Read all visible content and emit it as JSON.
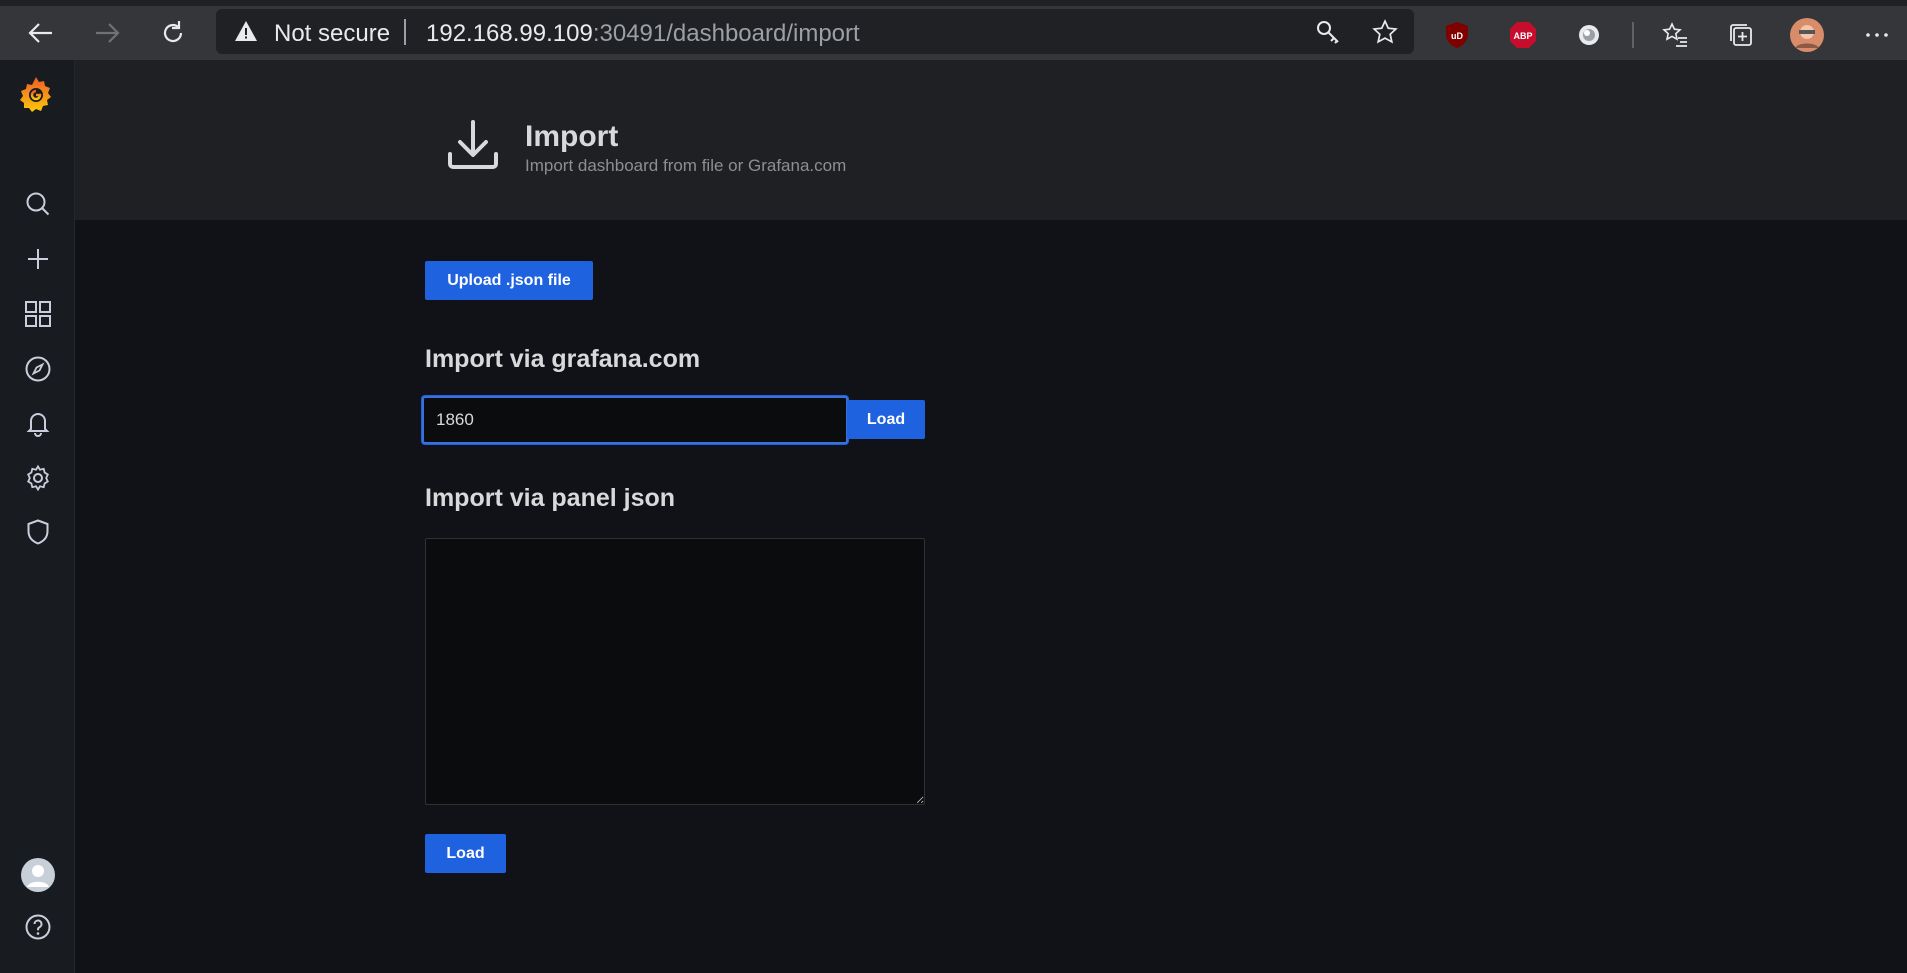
{
  "browser": {
    "security_label": "Not secure",
    "url_host": "192.168.99.109",
    "url_rest": ":30491/dashboard/import",
    "extensions": [
      "ublock-origin",
      "adblock-plus",
      "extension-circle"
    ]
  },
  "extensions": {
    "ublock_text": "uD",
    "abp_text": "ABP"
  },
  "sidebar": {
    "items": [
      "grafana-logo",
      "search",
      "create",
      "dashboards",
      "explore",
      "alerting",
      "configuration",
      "server-admin",
      "profile",
      "help"
    ]
  },
  "header": {
    "title": "Import",
    "subtitle": "Import dashboard from file or Grafana.com"
  },
  "upload": {
    "label": "Upload .json file"
  },
  "grafana_com": {
    "heading": "Import via grafana.com",
    "value": "1860",
    "load_label": "Load"
  },
  "panel_json": {
    "heading": "Import via panel json",
    "value": "",
    "load_label": "Load"
  },
  "colors": {
    "primary_button": "#1f62e0",
    "page_bg": "#111217",
    "sidebar_bg": "#181b1f",
    "header_bg": "#1f2024",
    "grafana_orange": "#f46800"
  }
}
